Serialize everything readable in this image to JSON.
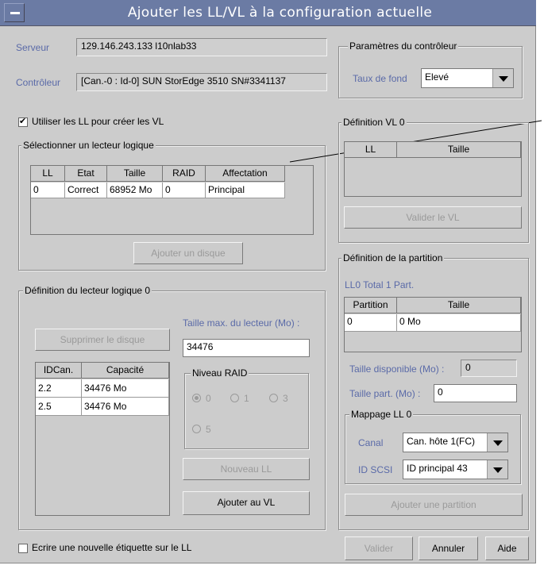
{
  "window": {
    "title": "Ajouter les LL/VL à la configuration actuelle"
  },
  "server": {
    "label": "Serveur",
    "value": "129.146.243.133 l10nlab33"
  },
  "controller": {
    "label": "Contrôleur",
    "value": "[Can.-0 : Id-0] SUN StorEdge 3510 SN#3341137"
  },
  "controller_params": {
    "legend": "Paramètres du contrôleur",
    "rate_label": "Taux de fond",
    "rate_value": "Elevé"
  },
  "use_ll": {
    "label": "Utiliser les LL pour créer les VL",
    "checked": true
  },
  "select_ld": {
    "legend": "Sélectionner un lecteur logique",
    "columns": [
      "LL",
      "Etat",
      "Taille",
      "RAID",
      "Affectation"
    ],
    "rows": [
      [
        "0",
        "Correct",
        "68952 Mo",
        "0",
        "Principal"
      ]
    ],
    "add_disk_button": "Ajouter un disque"
  },
  "vl_def": {
    "legend": "Définition VL 0",
    "columns": [
      "LL",
      "Taille"
    ],
    "validate_button": "Valider le VL"
  },
  "ld_def": {
    "legend": "Définition du lecteur logique 0",
    "remove_disk_button": "Supprimer le disque",
    "max_size_label": "Taille max. du lecteur (Mo) :",
    "max_size_value": "34476",
    "columns": [
      "IDCan.",
      "Capacité"
    ],
    "rows": [
      [
        "2.2",
        "34476 Mo"
      ],
      [
        "2.5",
        "34476 Mo"
      ]
    ],
    "raid_legend": "Niveau RAID",
    "raid_options": [
      "0",
      "1",
      "3",
      "5"
    ],
    "raid_selected": "0",
    "new_ll_button": "Nouveau LL",
    "add_to_vl_button": "Ajouter au VL"
  },
  "partition": {
    "legend": "Définition de la partition",
    "summary": "LL0 Total 1 Part.",
    "columns": [
      "Partition",
      "Taille"
    ],
    "rows": [
      [
        "0",
        "0 Mo"
      ]
    ],
    "available_label": "Taille disponible (Mo) :",
    "available_value": "0",
    "part_size_label": "Taille part. (Mo) :",
    "part_size_value": "0",
    "mapping_legend": "Mappage LL 0",
    "channel_label": "Canal",
    "channel_value": "Can. hôte 1(FC)",
    "scsi_label": "ID SCSI",
    "scsi_value": "ID principal 43",
    "add_partition_button": "Ajouter une partition"
  },
  "new_label_checkbox": {
    "label": "Ecrire une nouvelle étiquette sur le LL",
    "checked": false
  },
  "footer": {
    "validate": "Valider",
    "cancel": "Annuler",
    "help": "Aide"
  },
  "colors": {
    "title_bar": "#6b7ba4",
    "label_blue": "#5a6aa8",
    "window_bg": "#cccccc"
  }
}
